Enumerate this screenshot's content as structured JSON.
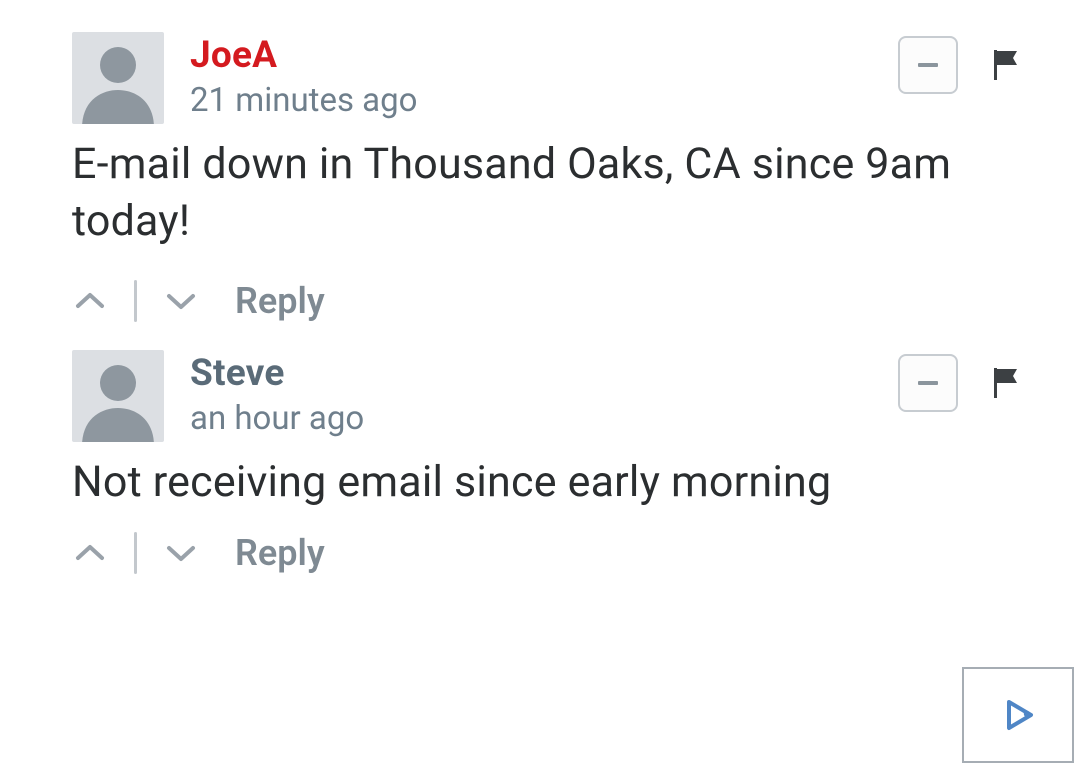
{
  "comments": [
    {
      "author": "JoeA",
      "author_highlight": true,
      "timestamp": "21 minutes ago",
      "body": "E-mail down in Thousand Oaks, CA since 9am today!",
      "reply_label": "Reply"
    },
    {
      "author": "Steve",
      "author_highlight": false,
      "timestamp": "an hour ago",
      "body": "Not receiving email since early morning",
      "reply_label": "Reply"
    }
  ],
  "colors": {
    "author_highlight": "#d41a1f",
    "author_normal": "#5a6b78"
  }
}
